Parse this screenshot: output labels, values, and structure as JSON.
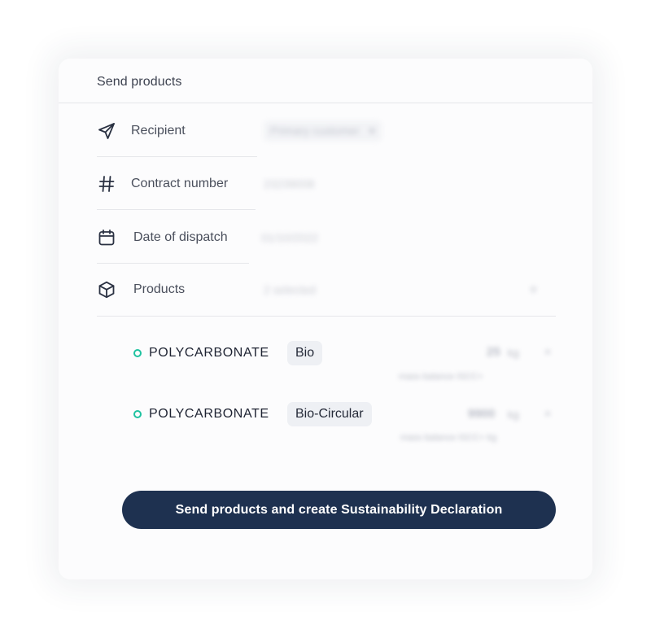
{
  "card": {
    "title": "Send products"
  },
  "fields": {
    "recipient": {
      "label": "Recipient",
      "value": "Primary customer",
      "icon": "send-icon"
    },
    "contract": {
      "label": "Contract number",
      "value": "23239008",
      "icon": "hash-icon"
    },
    "dispatch": {
      "label": "Date of dispatch",
      "value": "01/10/2022",
      "icon": "calendar-icon"
    },
    "products": {
      "label": "Products",
      "value": "2 selected",
      "icon": "box-icon"
    }
  },
  "product_items": [
    {
      "name": "POLYCARBONATE",
      "tag": "Bio",
      "qty": "25",
      "unit": "kg",
      "sub": "mass balance ISCC+"
    },
    {
      "name": "POLYCARBONATE",
      "tag": "Bio-Circular",
      "qty": "9900",
      "unit": "kg",
      "sub": "mass balance ISCC+ kg"
    }
  ],
  "actions": {
    "submit_label": "Send products and create Sustainability Declaration"
  },
  "colors": {
    "accent": "#1e3150",
    "status_dot": "#1fc2a0"
  }
}
